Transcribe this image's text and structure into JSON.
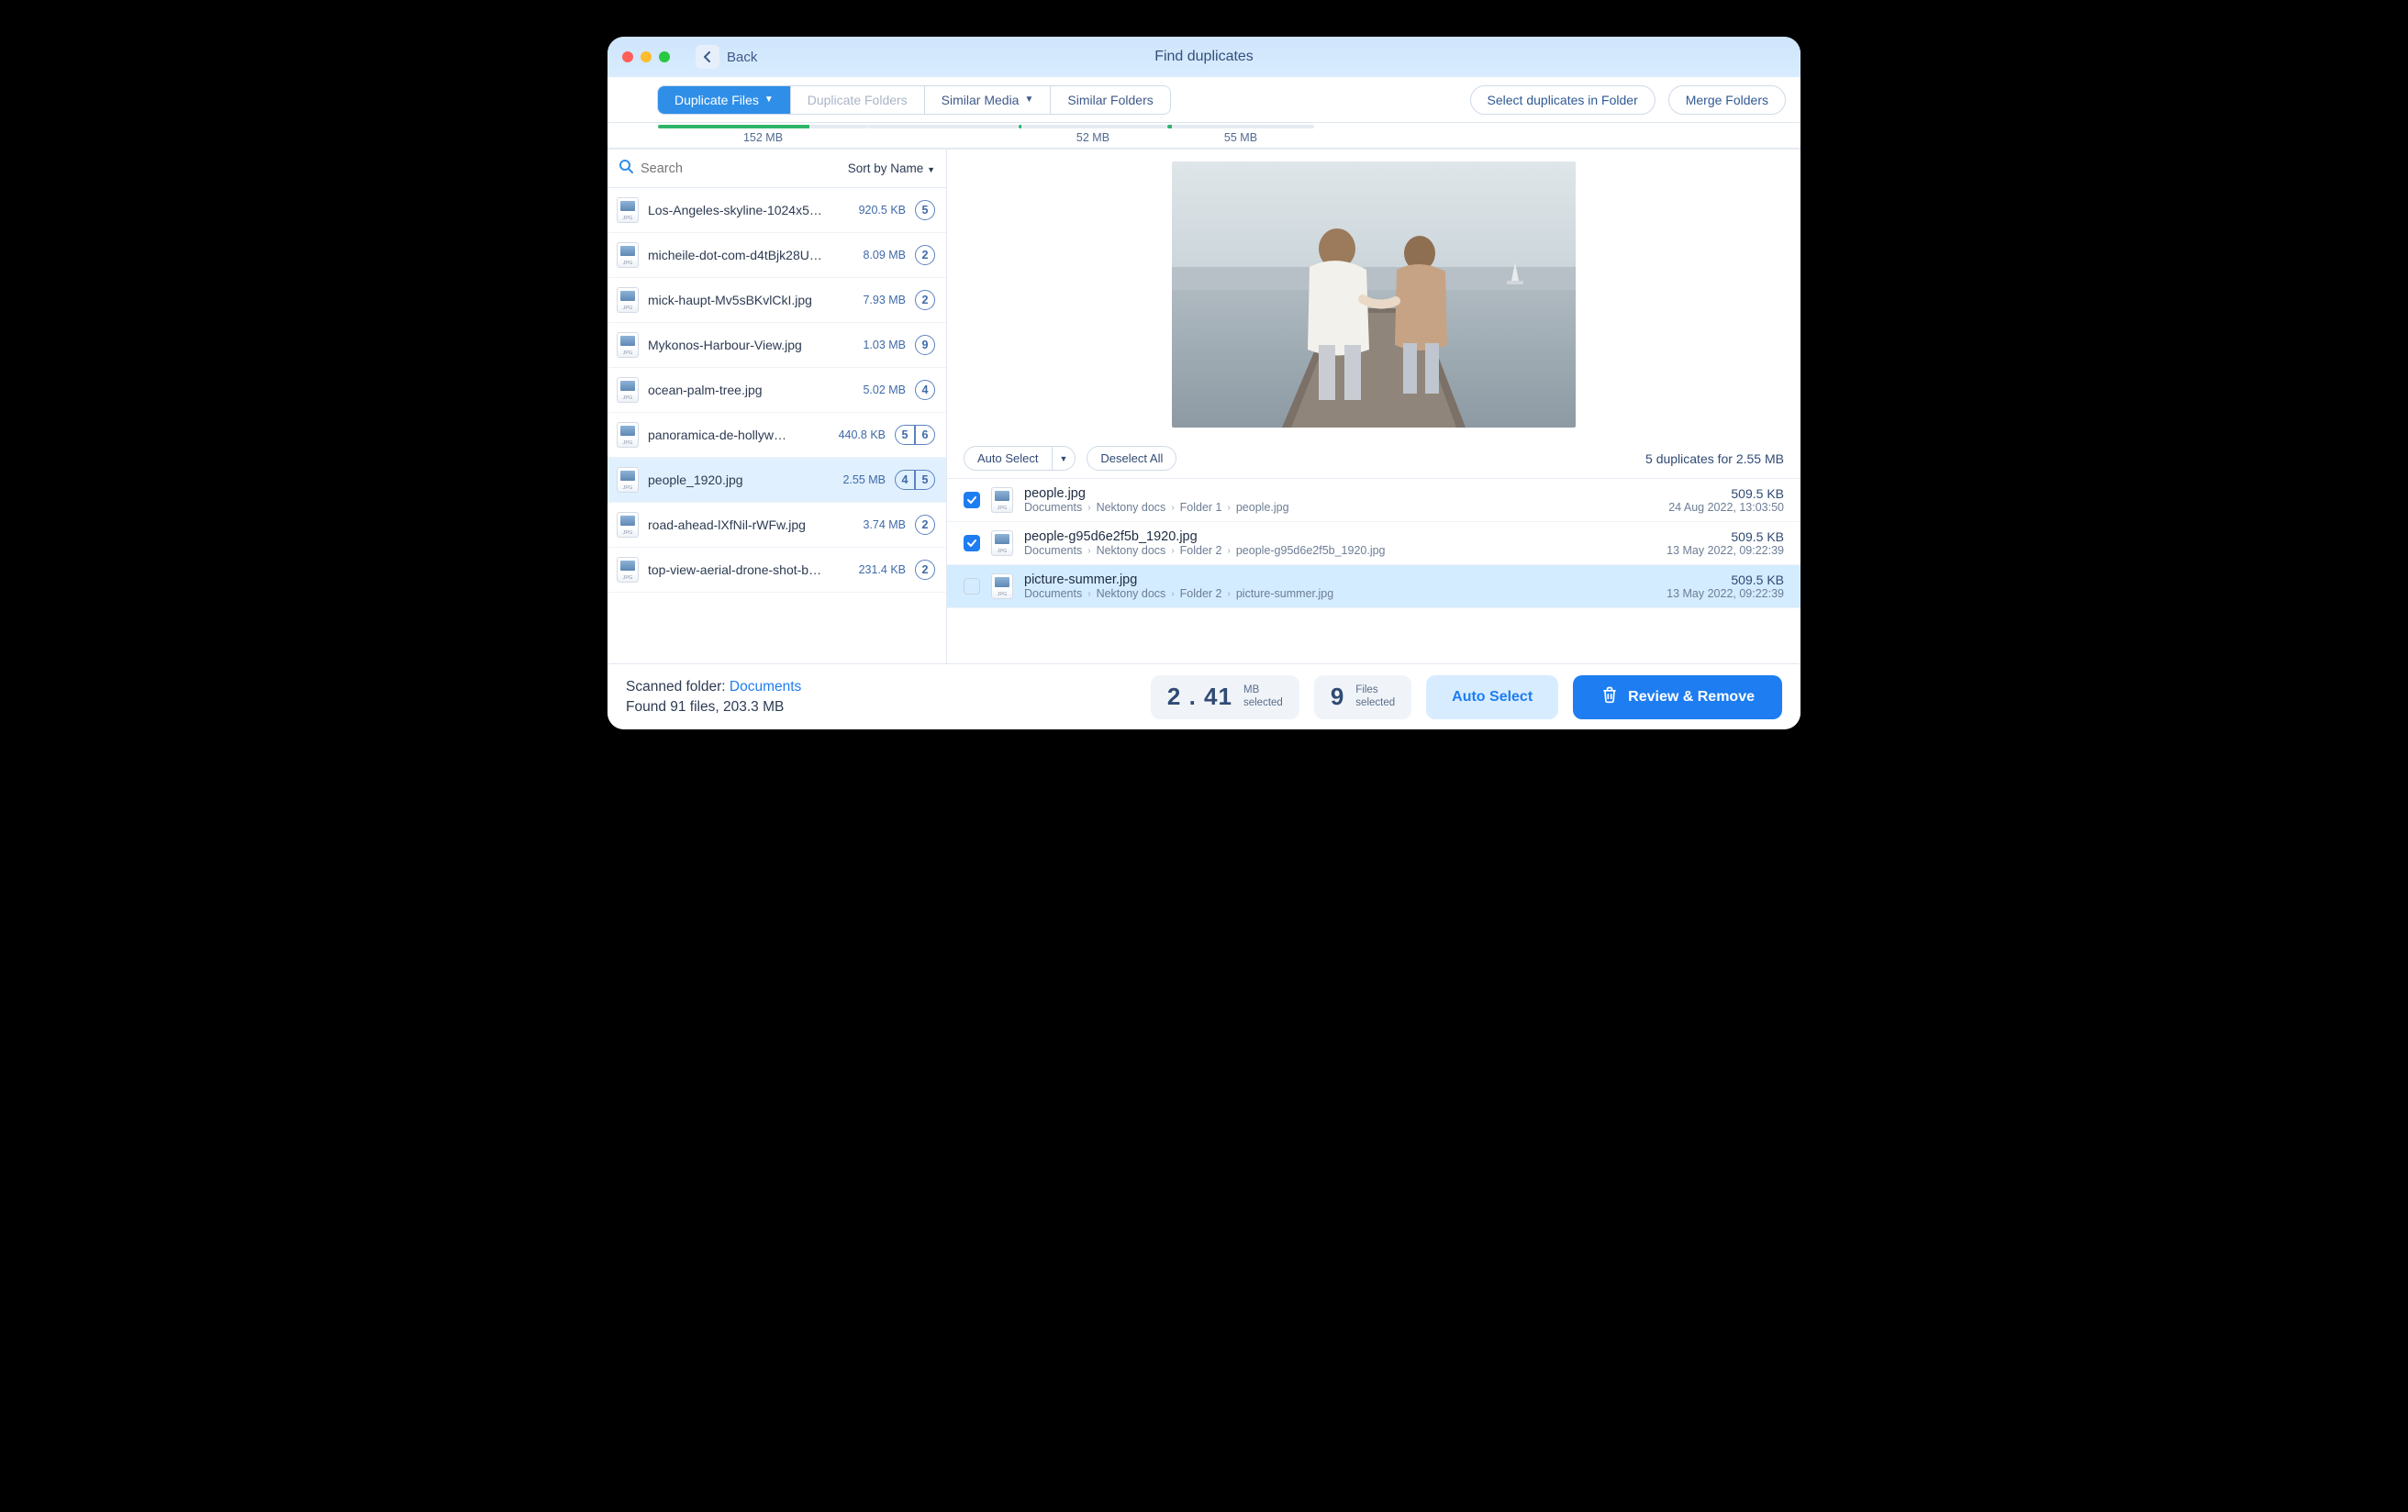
{
  "window": {
    "title": "Find duplicates",
    "back": "Back"
  },
  "tabs": {
    "dup_files": "Duplicate Files",
    "dup_folders": "Duplicate Folders",
    "similar_media": "Similar Media",
    "similar_folders": "Similar Folders"
  },
  "top_actions": {
    "select_in_folder": "Select duplicates in Folder",
    "merge": "Merge Folders"
  },
  "sizebar": {
    "s1": "152 MB",
    "s2": "",
    "s3": "52 MB",
    "s4": "55 MB"
  },
  "search": {
    "placeholder": "Search",
    "sort": "Sort by Name"
  },
  "list": [
    {
      "name": "Los-Angeles-skyline-1024x5…",
      "size": "920.5 KB",
      "badges": [
        "5"
      ]
    },
    {
      "name": "micheile-dot-com-d4tBjk28U…",
      "size": "8.09 MB",
      "badges": [
        "2"
      ]
    },
    {
      "name": "mick-haupt-Mv5sBKvlCkI.jpg",
      "size": "7.93 MB",
      "badges": [
        "2"
      ]
    },
    {
      "name": "Mykonos-Harbour-View.jpg",
      "size": "1.03 MB",
      "badges": [
        "9"
      ]
    },
    {
      "name": "ocean-palm-tree.jpg",
      "size": "5.02 MB",
      "badges": [
        "4"
      ]
    },
    {
      "name": "panoramica-de-hollyw…",
      "size": "440.8 KB",
      "badges": [
        "5",
        "6"
      ]
    },
    {
      "name": "people_1920.jpg",
      "size": "2.55 MB",
      "badges": [
        "4",
        "5"
      ],
      "selected": true
    },
    {
      "name": "road-ahead-lXfNil-rWFw.jpg",
      "size": "3.74 MB",
      "badges": [
        "2"
      ]
    },
    {
      "name": "top-view-aerial-drone-shot-b…",
      "size": "231.4 KB",
      "badges": [
        "2"
      ]
    }
  ],
  "selbar": {
    "auto": "Auto Select",
    "deselect": "Deselect All",
    "summary": "5 duplicates for 2.55 MB"
  },
  "dups": [
    {
      "checked": true,
      "name": "people.jpg",
      "path": [
        "Documents",
        "Nektony docs",
        "Folder 1",
        "people.jpg"
      ],
      "size": "509.5 KB",
      "date": "24 Aug 2022, 13:03:50"
    },
    {
      "checked": true,
      "name": "people-g95d6e2f5b_1920.jpg",
      "path": [
        "Documents",
        "Nektony docs",
        "Folder 2",
        "people-g95d6e2f5b_1920.jpg"
      ],
      "size": "509.5 KB",
      "date": "13 May 2022, 09:22:39"
    },
    {
      "checked": false,
      "hl": true,
      "name": "picture-summer.jpg",
      "path": [
        "Documents",
        "Nektony docs",
        "Folder 2",
        "picture-summer.jpg"
      ],
      "size": "509.5 KB",
      "date": "13 May 2022, 09:22:39"
    }
  ],
  "footer": {
    "scanned_label": "Scanned folder: ",
    "scanned_link": "Documents",
    "found": "Found 91 files, 203.3 MB",
    "mb_val": "2 . 41",
    "mb_unit_top": "MB",
    "mb_unit_bot": "selected",
    "files_val": "9",
    "files_unit_top": "Files",
    "files_unit_bot": "selected",
    "auto": "Auto Select",
    "review": "Review & Remove"
  }
}
